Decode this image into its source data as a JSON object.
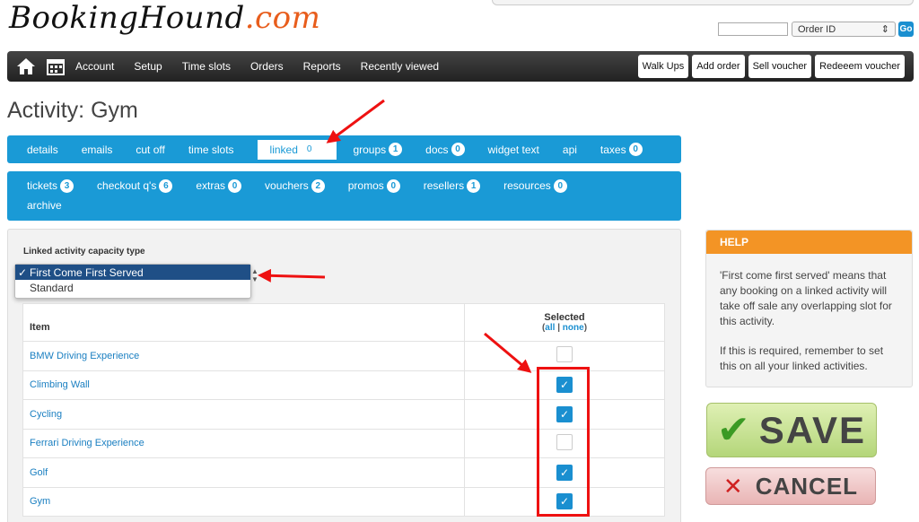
{
  "header": {
    "logo_main": "BookingHound",
    "logo_suffix": ".com",
    "order_id_value": "",
    "order_select_value": "Order ID",
    "go_label": "Go"
  },
  "nav": {
    "links": [
      "Account",
      "Setup",
      "Time slots",
      "Orders",
      "Reports",
      "Recently viewed"
    ],
    "buttons": [
      "Walk Ups",
      "Add order",
      "Sell voucher",
      "Redeeem voucher"
    ]
  },
  "page": {
    "title": "Activity: Gym"
  },
  "tabs_row1": [
    {
      "label": "details"
    },
    {
      "label": "emails"
    },
    {
      "label": "cut off"
    },
    {
      "label": "time slots"
    },
    {
      "label": "linked",
      "count": "0",
      "active": true
    },
    {
      "label": "groups",
      "count": "1"
    },
    {
      "label": "docs",
      "count": "0"
    },
    {
      "label": "widget text"
    },
    {
      "label": "api"
    },
    {
      "label": "taxes",
      "count": "0"
    }
  ],
  "tabs_row2": [
    {
      "label": "tickets",
      "count": "3"
    },
    {
      "label": "checkout q's",
      "count": "6"
    },
    {
      "label": "extras",
      "count": "0"
    },
    {
      "label": "vouchers",
      "count": "2"
    },
    {
      "label": "promos",
      "count": "0"
    },
    {
      "label": "resellers",
      "count": "1"
    },
    {
      "label": "resources",
      "count": "0"
    }
  ],
  "tabs_row3": [
    {
      "label": "archive"
    }
  ],
  "capacity": {
    "label": "Linked activity capacity type",
    "options": [
      {
        "label": "First Come First Served",
        "selected": true,
        "check": "✓"
      },
      {
        "label": "Standard",
        "selected": false,
        "check": ""
      }
    ]
  },
  "table": {
    "col_item": "Item",
    "col_selected": "Selected",
    "all_label": "all",
    "sep": "|",
    "none_label": "none",
    "rows": [
      {
        "name": "BMW Driving Experience",
        "selected": false
      },
      {
        "name": "Climbing Wall",
        "selected": true
      },
      {
        "name": "Cycling",
        "selected": true
      },
      {
        "name": "Ferrari Driving Experience",
        "selected": false
      },
      {
        "name": "Golf",
        "selected": true
      },
      {
        "name": "Gym",
        "selected": true
      }
    ]
  },
  "help": {
    "title": "HELP",
    "p1": "'First come first served' means that any booking on a linked activity will take off sale any overlapping slot for this activity.",
    "p2": "If this is required, remember to set this on all your linked activities."
  },
  "actions": {
    "save": "SAVE",
    "cancel": "CANCEL"
  },
  "colors": {
    "accent": "#1a9ad6",
    "help_orange": "#f39425",
    "annotation_red": "#e11111"
  }
}
